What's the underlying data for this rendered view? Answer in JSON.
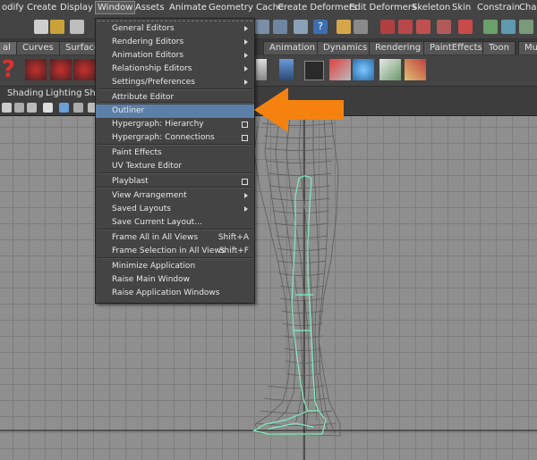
{
  "menubar": {
    "items": [
      "odify",
      "Create",
      "Display",
      "Window",
      "Assets",
      "Animate",
      "Geometry Cache",
      "Create Deformers",
      "Edit Deformers",
      "Skeleton",
      "Skin",
      "Constrain",
      "Chara"
    ]
  },
  "shelf_tabs": [
    "al",
    "Curves",
    "Surfaces",
    "Animation",
    "Dynamics",
    "Rendering",
    "PaintEffects",
    "Toon",
    "Muscle"
  ],
  "panel_menu": [
    "Shading",
    "Lighting",
    "Sho"
  ],
  "window_menu": {
    "items": [
      {
        "label": "General Editors",
        "kind": "submenu"
      },
      {
        "label": "Rendering Editors",
        "kind": "submenu"
      },
      {
        "label": "Animation Editors",
        "kind": "submenu"
      },
      {
        "label": "Relationship Editors",
        "kind": "submenu"
      },
      {
        "label": "Settings/Preferences",
        "kind": "submenu"
      },
      {
        "label": "Attribute Editor",
        "kind": "plain"
      },
      {
        "label": "Outliner",
        "kind": "plain",
        "highlighted": true
      },
      {
        "label": "Hypergraph: Hierarchy",
        "kind": "option"
      },
      {
        "label": "Hypergraph: Connections",
        "kind": "option"
      },
      {
        "label": "Paint Effects",
        "kind": "plain"
      },
      {
        "label": "UV Texture Editor",
        "kind": "plain"
      },
      {
        "label": "Playblast",
        "kind": "option"
      },
      {
        "label": "View Arrangement",
        "kind": "submenu"
      },
      {
        "label": "Saved Layouts",
        "kind": "submenu"
      },
      {
        "label": "Save Current Layout...",
        "kind": "plain"
      },
      {
        "label": "Frame All in All Views",
        "kind": "shortcut",
        "shortcut": "Shift+A"
      },
      {
        "label": "Frame Selection in All Views",
        "kind": "shortcut",
        "shortcut": "Shift+F"
      },
      {
        "label": "Minimize Application",
        "kind": "plain"
      },
      {
        "label": "Raise Main Window",
        "kind": "plain"
      },
      {
        "label": "Raise Application Windows",
        "kind": "plain"
      }
    ]
  },
  "colors": {
    "highlight": "#5c7fa8",
    "arrow": "#f5820f",
    "wire": "#7ef0c0",
    "menu_bg": "#444444"
  }
}
